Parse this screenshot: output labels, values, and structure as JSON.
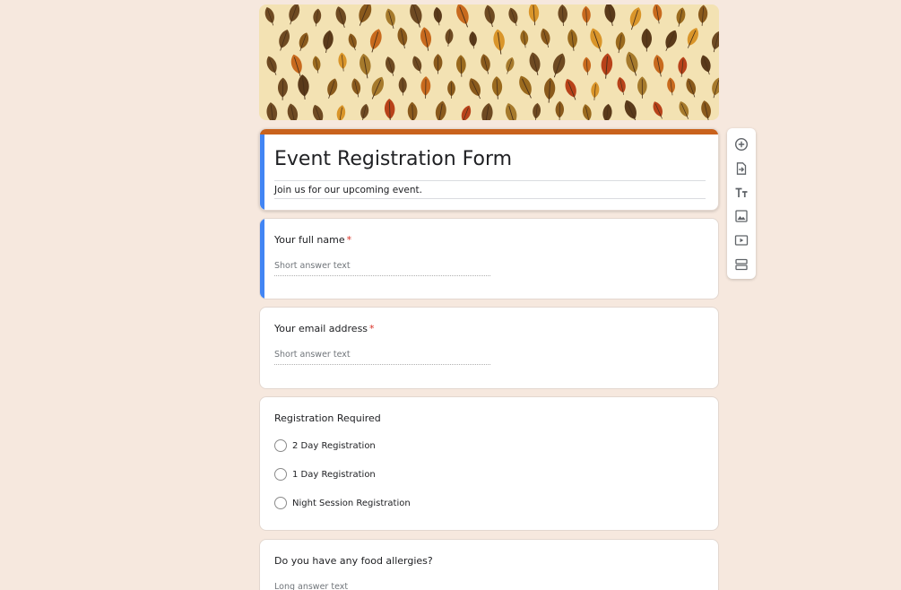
{
  "form": {
    "title": "Event Registration Form",
    "description": "Join us for our upcoming event.",
    "accent_color": "#c9621d",
    "active_color": "#4285f4"
  },
  "questions": {
    "full_name": {
      "title": "Your full name",
      "required_mark": "*",
      "placeholder": "Short answer text"
    },
    "email": {
      "title": "Your email address",
      "required_mark": "*",
      "placeholder": "Short answer text"
    },
    "registration": {
      "title": "Registration Required",
      "options": [
        "2 Day Registration",
        "1 Day Registration",
        "Night Session Registration"
      ]
    },
    "allergies": {
      "title": "Do you have any food allergies?",
      "placeholder": "Long answer text"
    }
  },
  "toolbar": {
    "icons": [
      "add-question-icon",
      "import-questions-icon",
      "add-title-icon",
      "add-image-icon",
      "add-video-icon",
      "add-section-icon"
    ]
  }
}
